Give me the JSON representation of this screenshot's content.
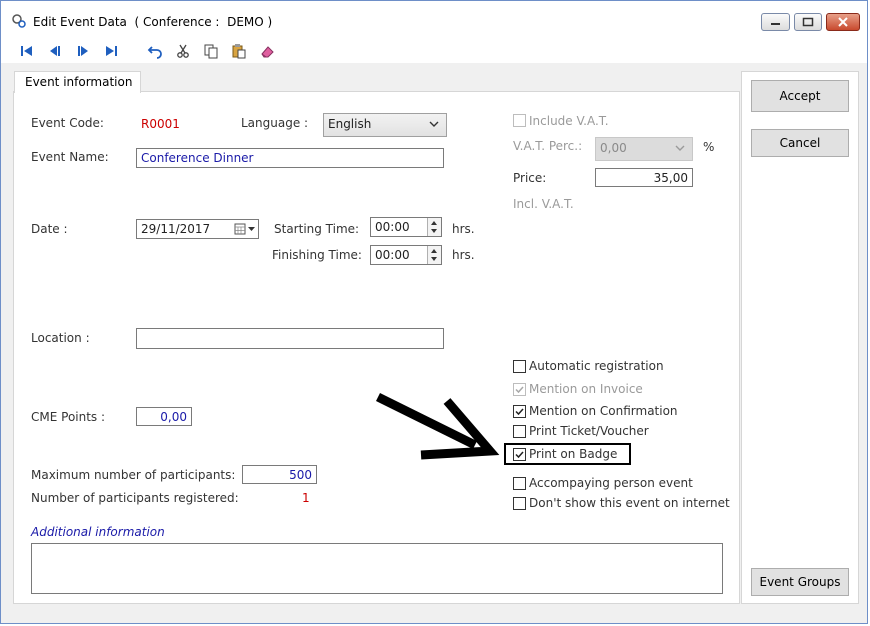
{
  "window": {
    "title": "Edit Event Data  ( Conference :  DEMO )"
  },
  "tab": {
    "label": "Event information"
  },
  "fields": {
    "event_code_label": "Event Code:",
    "event_code_value": "R0001",
    "language_label": "Language :",
    "language_value": "English",
    "event_name_label": "Event Name:",
    "event_name_value": "Conference Dinner",
    "date_label": "Date :",
    "date_value": "29/11/2017",
    "starting_time_label": "Starting Time:",
    "starting_time_value": "00:00",
    "finishing_time_label": "Finishing Time:",
    "finishing_time_value": "00:00",
    "hrs_1": "hrs.",
    "hrs_2": "hrs.",
    "location_label": "Location :",
    "location_value": "",
    "cme_label": "CME Points :",
    "cme_value": "0,00",
    "max_participants_label": "Maximum number of participants:",
    "max_participants_value": "500",
    "registered_label": "Number of participants registered:",
    "registered_value": "1",
    "additional_label": "Additional information",
    "additional_value": ""
  },
  "vat": {
    "include_label": "Include V.A.T.",
    "perc_label": "V.A.T. Perc.:",
    "perc_value": "0,00",
    "percent_sign": "%",
    "price_label": "Price:",
    "price_value": "35,00",
    "incl_label": "Incl. V.A.T."
  },
  "options": [
    {
      "label": "Automatic registration",
      "checked": false,
      "disabled": false
    },
    {
      "label": "Mention on Invoice",
      "checked": true,
      "disabled": true
    },
    {
      "label": "Mention on Confirmation",
      "checked": true,
      "disabled": false
    },
    {
      "label": "Print Ticket/Voucher",
      "checked": false,
      "disabled": false
    },
    {
      "label": "Print on Badge",
      "checked": true,
      "disabled": false
    },
    {
      "label": "Accompaying person event",
      "checked": false,
      "disabled": false
    },
    {
      "label": "Don't show this event on internet",
      "checked": false,
      "disabled": false
    }
  ],
  "buttons": {
    "accept": "Accept",
    "cancel": "Cancel",
    "event_groups": "Event Groups"
  },
  "colors": {
    "code_red": "#cc0000",
    "value_blue": "#1a1aa8",
    "toolbar_blue": "#1f5fbf"
  }
}
